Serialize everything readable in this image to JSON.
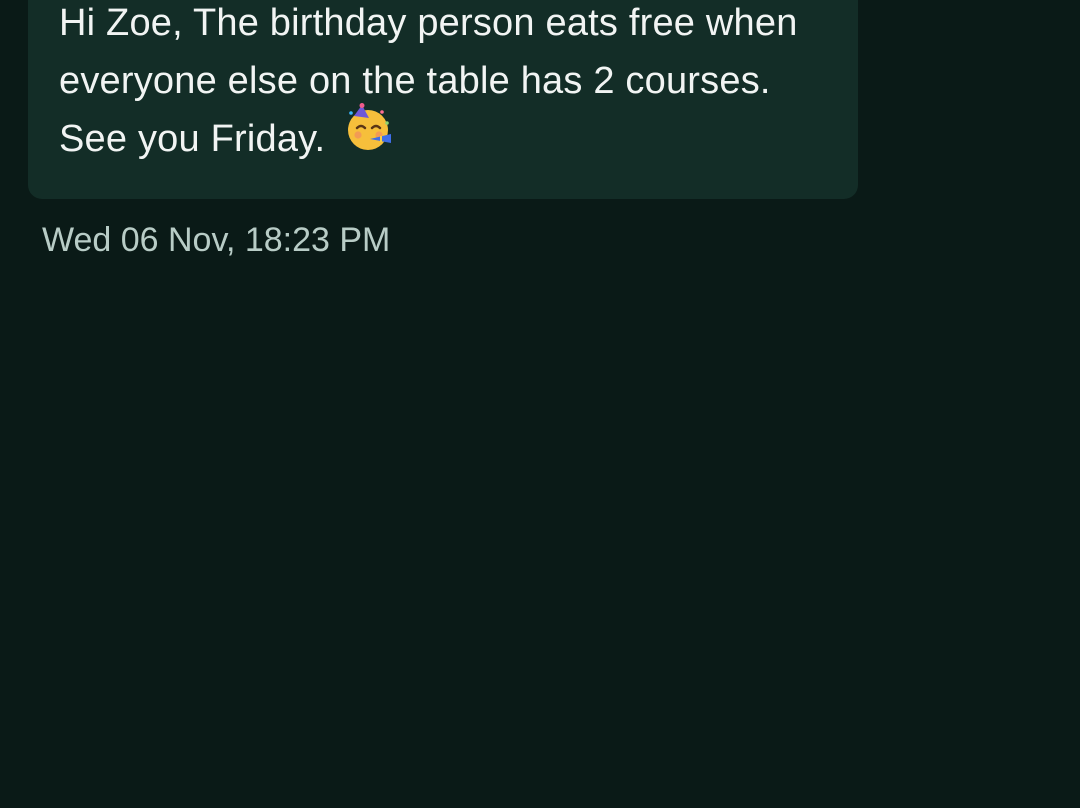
{
  "message": {
    "lines": [
      "Hi Zoe, The birthday person eats free when",
      "everyone else on the table has 2 courses.",
      "See you Friday."
    ],
    "emoji_icon": "party-face-icon",
    "timestamp": "Wed 06 Nov, 18:23 PM"
  },
  "colors": {
    "background": "#0a1a17",
    "bubble": "#132d27",
    "message_text": "#f1f4f3",
    "timestamp_text": "#b8ccc6"
  }
}
